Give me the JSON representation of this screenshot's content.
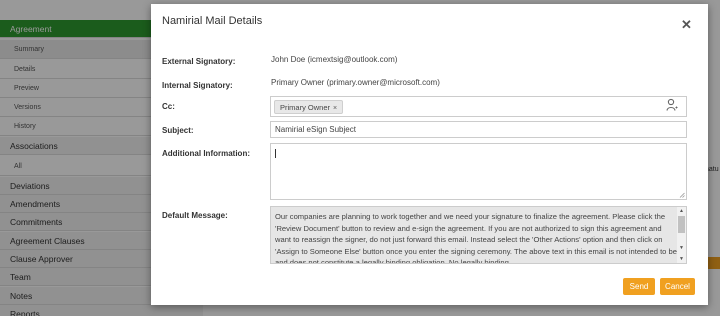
{
  "sidebar": {
    "items": [
      {
        "label": "Agreement",
        "kind": "main",
        "active": true
      },
      {
        "label": "Summary",
        "kind": "sub",
        "selected": true
      },
      {
        "label": "Details",
        "kind": "sub"
      },
      {
        "label": "Preview",
        "kind": "sub"
      },
      {
        "label": "Versions",
        "kind": "sub"
      },
      {
        "label": "History",
        "kind": "sub"
      },
      {
        "label": "Associations",
        "kind": "main"
      },
      {
        "label": "All",
        "kind": "sub"
      },
      {
        "label": "Deviations",
        "kind": "main"
      },
      {
        "label": "Amendments",
        "kind": "main"
      },
      {
        "label": "Commitments",
        "kind": "main"
      },
      {
        "label": "Agreement Clauses",
        "kind": "main"
      },
      {
        "label": "Clause Approver",
        "kind": "main"
      },
      {
        "label": "Team",
        "kind": "main"
      },
      {
        "label": "Notes",
        "kind": "main"
      },
      {
        "label": "Reports",
        "kind": "main"
      }
    ]
  },
  "background": {
    "right_fragment": "natu"
  },
  "modal": {
    "title": "Namirial Mail Details",
    "close_icon": "close-icon",
    "fields": {
      "external_signatory": {
        "label": "External Signatory:",
        "value": "John Doe (icmextsig@outlook.com)"
      },
      "internal_signatory": {
        "label": "Internal Signatory:",
        "value": "Primary Owner (primary.owner@microsoft.com)"
      },
      "cc": {
        "label": "Cc:",
        "chip": "Primary Owner",
        "chip_remove": "×",
        "icon": "person-icon"
      },
      "subject": {
        "label": "Subject:",
        "value": "Namirial eSign Subject"
      },
      "additional_information": {
        "label": "Additional Information:",
        "value": ""
      },
      "default_message": {
        "label": "Default Message:",
        "value": "Our companies are planning to work together and we need your signature to finalize the agreement. Please click the 'Review Document' button to review and e-sign the agreement. If you are not authorized to sign this agreement and want to reassign the signer, do not just forward this email. Instead select the 'Other Actions' option and then click on 'Assign to Someone Else' button once you enter the signing ceremony. The above text in this email is not intended to be and does not constitute a legally binding obligation. No legally binding"
      }
    },
    "buttons": {
      "send": "Send",
      "cancel": "Cancel"
    },
    "accent_color": "#f0a020"
  }
}
